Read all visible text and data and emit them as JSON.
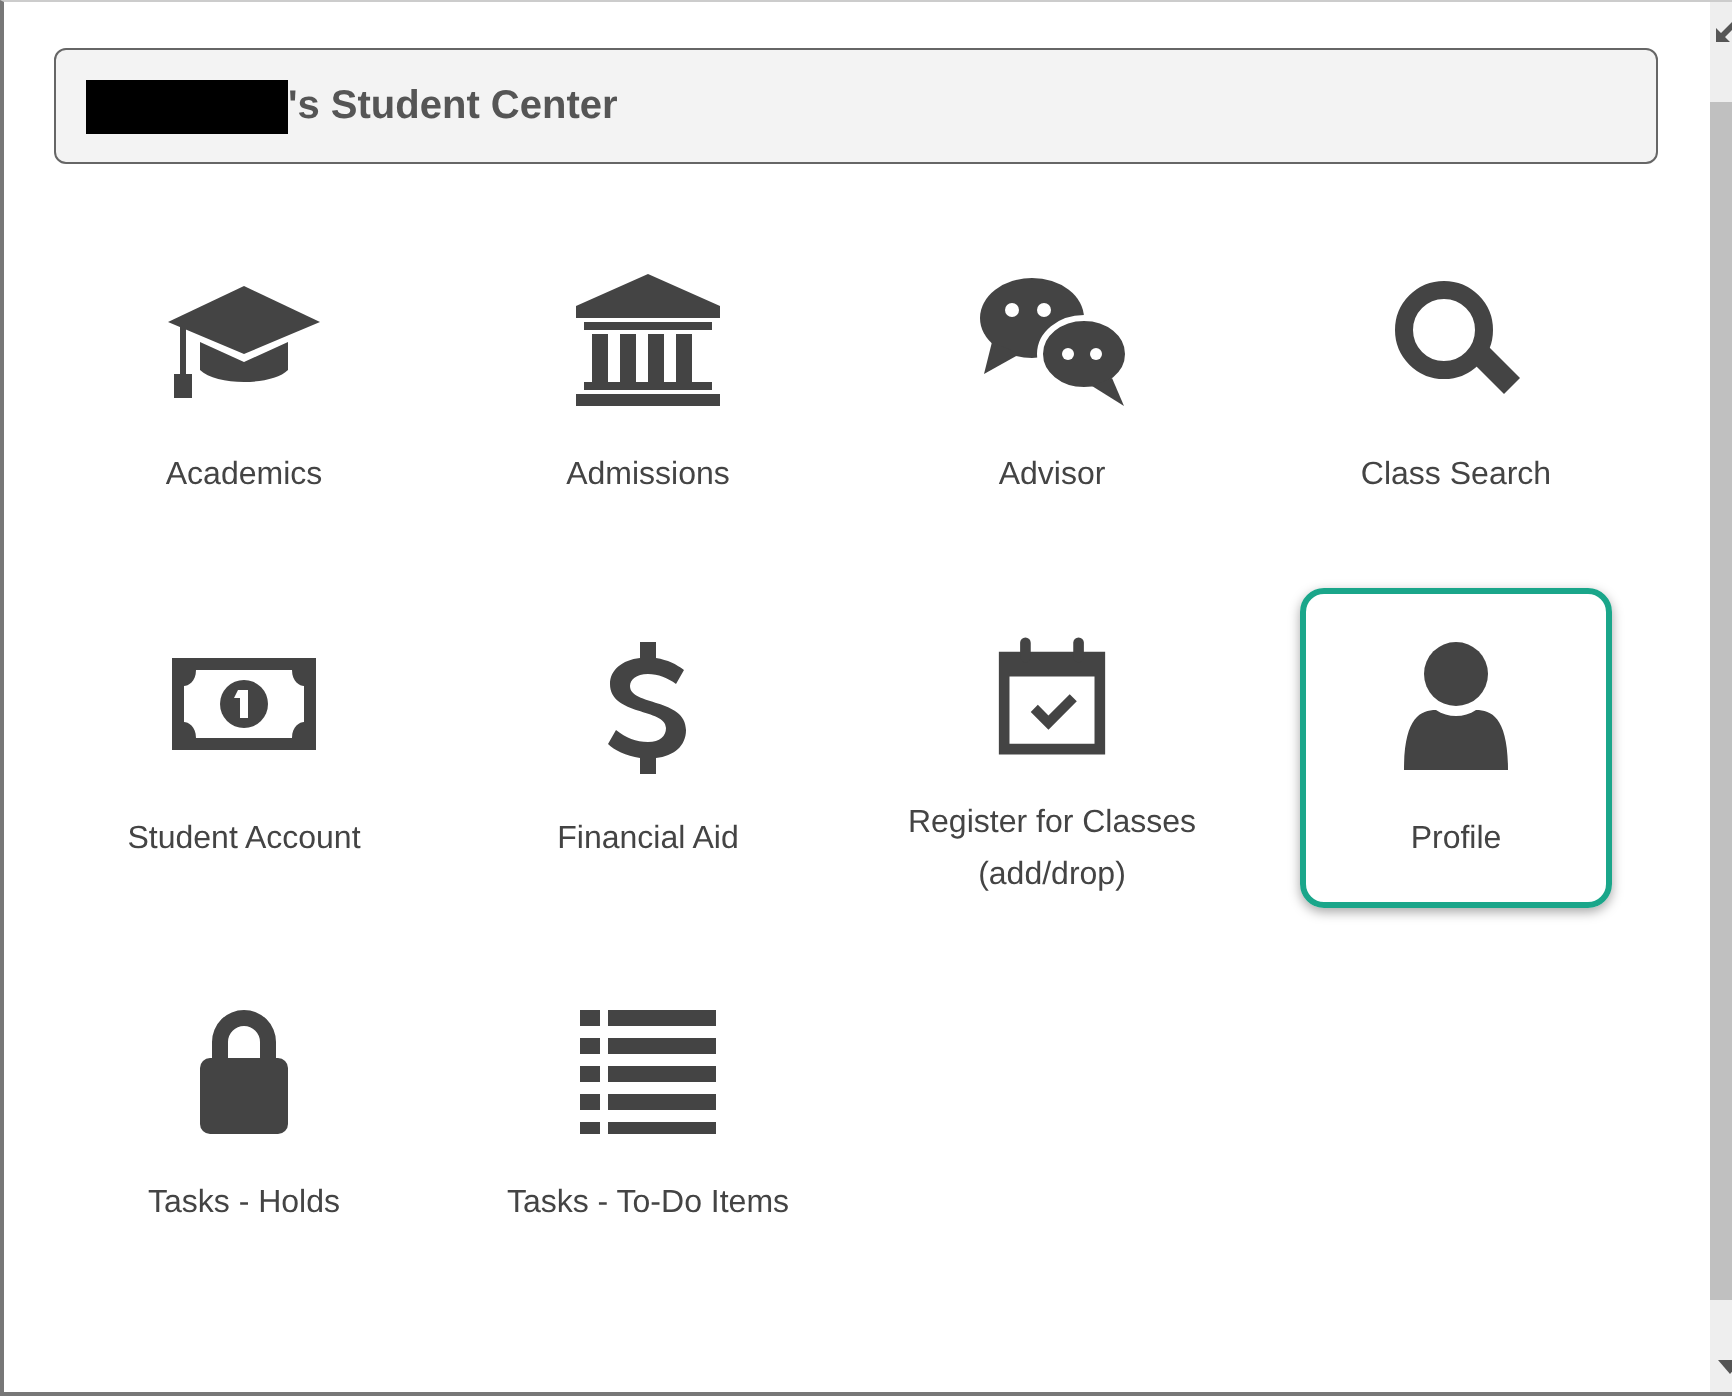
{
  "header": {
    "title": "'s Student Center"
  },
  "tiles": [
    {
      "label": "Academics",
      "selected": false
    },
    {
      "label": "Admissions",
      "selected": false
    },
    {
      "label": "Advisor",
      "selected": false
    },
    {
      "label": "Class Search",
      "selected": false
    },
    {
      "label": "Student Account",
      "selected": false
    },
    {
      "label": "Financial Aid",
      "selected": false
    },
    {
      "label": "Register for Classes (add/drop)",
      "selected": false
    },
    {
      "label": "Profile",
      "selected": true
    },
    {
      "label": "Tasks - Holds",
      "selected": false
    },
    {
      "label": "Tasks - To-Do Items",
      "selected": false
    }
  ]
}
